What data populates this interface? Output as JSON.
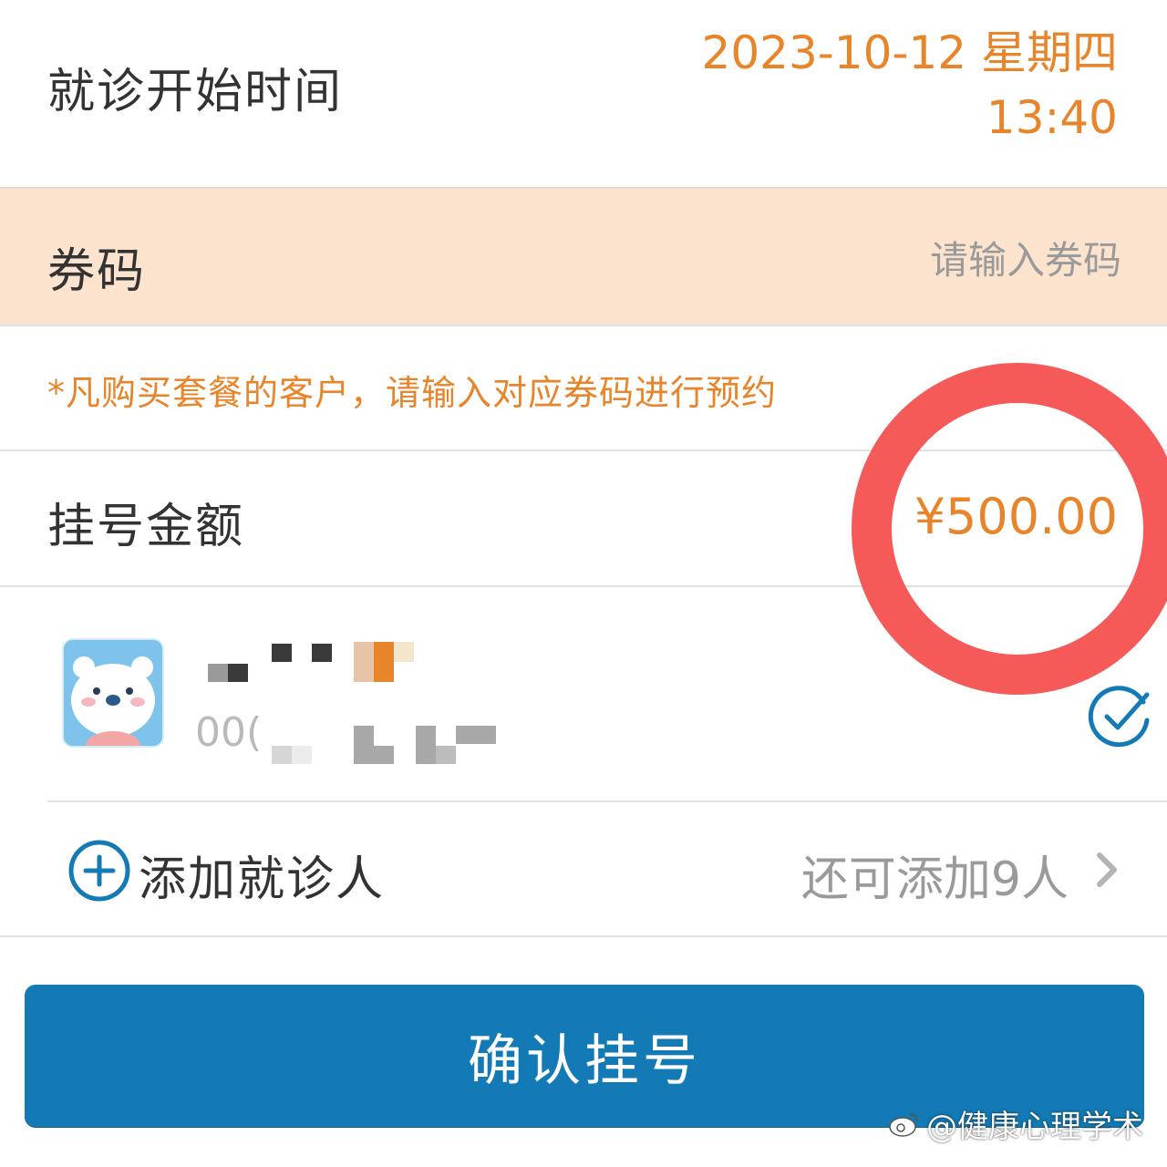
{
  "visit_time": {
    "label": "就诊开始时间",
    "date": "2023-10-12 星期四",
    "time": "13:40"
  },
  "coupon": {
    "label": "券码",
    "placeholder": "请输入券码",
    "note": "*凡购买套餐的客户，请输入对应券码进行预约"
  },
  "fee": {
    "label": "挂号金额",
    "amount": "¥500.00"
  },
  "patient": {
    "id_prefix": "00(",
    "selected": true,
    "avatar_icon": "polar-bear-avatar-icon"
  },
  "add_patient": {
    "label": "添加就诊人",
    "remaining": "还可添加9人",
    "icon": "plus-circle-icon",
    "chevron": "chevron-right-icon"
  },
  "confirm_button": {
    "label": "确认挂号"
  },
  "watermark": {
    "text": "@健康心理学术"
  },
  "colors": {
    "accent_orange": "#e8842a",
    "coupon_bg": "#fce3cd",
    "primary_blue": "#137ab5",
    "highlight_red": "#f55a58"
  }
}
